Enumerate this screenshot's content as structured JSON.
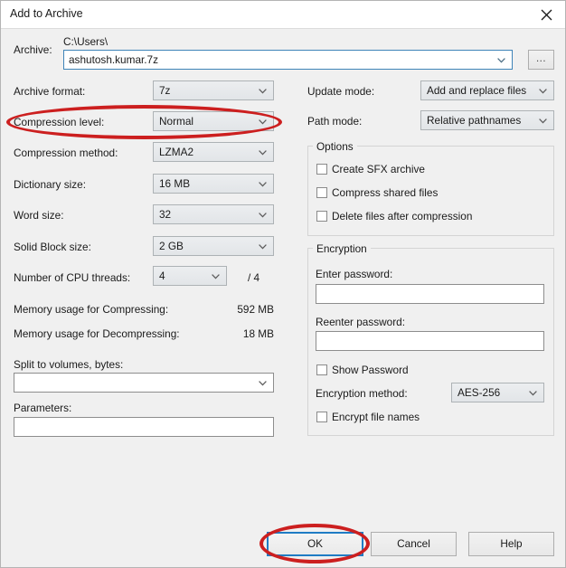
{
  "window": {
    "title": "Add to Archive",
    "close_icon": "close-icon"
  },
  "archive": {
    "label": "Archive:",
    "path_prefix": "C:\\Users\\",
    "filename": "ashutosh.kumar.7z",
    "browse_label": "..."
  },
  "left_column": {
    "archive_format": {
      "label": "Archive format:",
      "value": "7z"
    },
    "compression_level": {
      "label": "Compression level:",
      "value": "Normal"
    },
    "compression_method": {
      "label": "Compression method:",
      "value": "LZMA2"
    },
    "dictionary_size": {
      "label": "Dictionary size:",
      "value": "16 MB"
    },
    "word_size": {
      "label": "Word size:",
      "value": "32"
    },
    "solid_block_size": {
      "label": "Solid Block size:",
      "value": "2 GB"
    },
    "cpu_threads": {
      "label": "Number of CPU threads:",
      "value": "4",
      "total": "/ 4"
    },
    "memory_compressing": {
      "label": "Memory usage for Compressing:",
      "value": "592 MB"
    },
    "memory_decompressing": {
      "label": "Memory usage for Decompressing:",
      "value": "18 MB"
    },
    "split_volumes": {
      "label": "Split to volumes, bytes:",
      "value": ""
    },
    "parameters": {
      "label": "Parameters:",
      "value": ""
    }
  },
  "right_column": {
    "update_mode": {
      "label": "Update mode:",
      "value": "Add and replace files"
    },
    "path_mode": {
      "label": "Path mode:",
      "value": "Relative pathnames"
    },
    "options": {
      "caption": "Options",
      "items": [
        {
          "label": "Create SFX archive",
          "checked": false
        },
        {
          "label": "Compress shared files",
          "checked": false
        },
        {
          "label": "Delete files after compression",
          "checked": false
        }
      ]
    },
    "encryption": {
      "caption": "Encryption",
      "enter_password_label": "Enter password:",
      "enter_password_value": "",
      "reenter_password_label": "Reenter password:",
      "reenter_password_value": "",
      "show_password": {
        "label": "Show Password",
        "checked": false
      },
      "method_label": "Encryption method:",
      "method_value": "AES-256",
      "encrypt_file_names": {
        "label": "Encrypt file names",
        "checked": false
      }
    }
  },
  "buttons": {
    "ok": "OK",
    "cancel": "Cancel",
    "help": "Help"
  },
  "annotations": {
    "color": "#cc1f1f",
    "highlighted": [
      "compression-level-row",
      "ok-button"
    ]
  }
}
